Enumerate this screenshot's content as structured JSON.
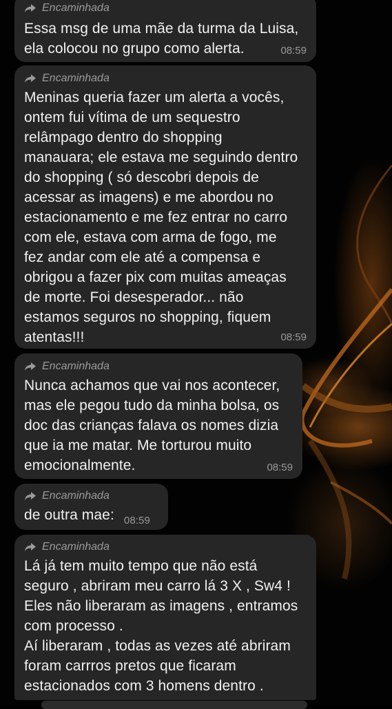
{
  "forward_label": "Encaminhada",
  "forward_icon": "forward-arrow-icon",
  "colors": {
    "bubble": "#262626",
    "text": "#f1f1f1",
    "meta": "#9b9b9b",
    "background": "#000000",
    "wallpaper_accent": "#b8661e"
  },
  "messages": [
    {
      "text": "Essa msg de uma mãe da turma da Luisa,\nela colocou no grupo como alerta.",
      "time": "08:59"
    },
    {
      "text": "Meninas queria fazer um alerta a vocês,\nontem fui vítima de um sequestro\nrelâmpago dentro do shopping\nmanauara; ele estava me seguindo dentro\ndo shopping ( só descobri depois de\nacessar as imagens) e me abordou no\nestacionamento e me fez entrar no carro\ncom ele, estava com arma de fogo, me\nfez andar com ele até a compensa e\nobrigou a fazer pix com muitas ameaças\nde morte. Foi desesperador... não\nestamos seguros no shopping, fiquem\natentas!!!",
      "time": "08:59"
    },
    {
      "text": "Nunca achamos que vai nos acontecer,\nmas ele pegou tudo da minha bolsa, os\ndoc das crianças falava os nomes dizia\nque ia me matar. Me torturou muito\nemocionalmente.",
      "time": "08:59"
    },
    {
      "text": "de outra mae:",
      "time": "08:59"
    },
    {
      "text": "Lá já tem muito tempo que não está\nseguro , abriram meu carro lá 3 X , Sw4 !\nEles não liberaram as imagens , entramos\ncom processo .\nAí liberaram , todas as vezes até abriram\nforam carrros pretos que ficaram\nestacionados com 3 homens dentro ."
    }
  ]
}
